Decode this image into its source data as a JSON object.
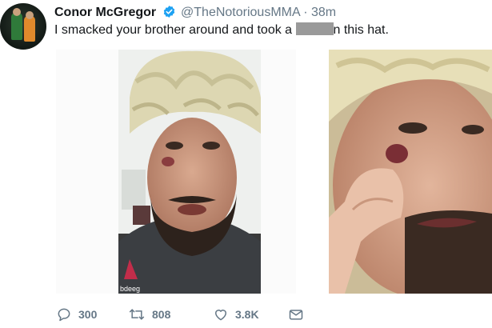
{
  "tweet": {
    "author_name": "Conor McGregor",
    "handle": "@TheNotoriousMMA",
    "separator": "·",
    "time": "38m",
    "text_before": "I smacked your brother around and took a ",
    "text_after": "n this hat.",
    "verified_icon": "verified-badge-icon"
  },
  "media": {
    "photo1_watermark": "bdeeg",
    "photo_count": 2
  },
  "actions": {
    "replies": "300",
    "retweets": "808",
    "likes": "3.8K",
    "reply_icon": "speech-bubble-icon",
    "retweet_icon": "retweet-arrows-icon",
    "like_icon": "heart-icon",
    "dm_icon": "envelope-icon"
  },
  "colors": {
    "verified_blue": "#1da1f2",
    "secondary_text": "#657786",
    "primary_text": "#14171a"
  }
}
